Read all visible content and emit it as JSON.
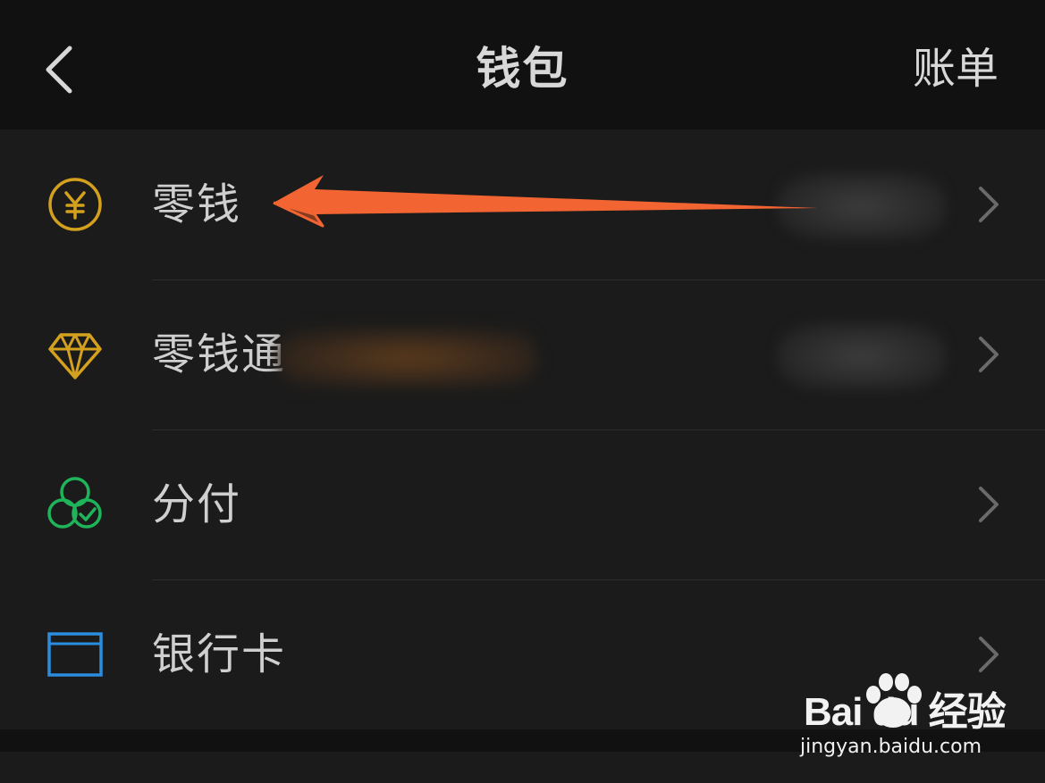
{
  "header": {
    "title": "钱包",
    "right_action": "账单",
    "back_icon": "chevron-left-icon"
  },
  "wallet_items": [
    {
      "label": "零钱",
      "icon": "yuan-coin-icon",
      "icon_color": "#d4a11e",
      "value_hidden": true
    },
    {
      "label": "零钱通",
      "icon": "diamond-icon",
      "icon_color": "#d4a11e",
      "value_hidden": true
    },
    {
      "label": "分付",
      "icon": "overlapping-circles-check-icon",
      "icon_color": "#1fb45a"
    },
    {
      "label": "银行卡",
      "icon": "card-icon",
      "icon_color": "#2b8de0"
    }
  ],
  "annotation": {
    "arrow_color": "#f26532",
    "points_to": "零钱"
  },
  "watermark": {
    "brand": "Bai du 经验",
    "url": "jingyan.baidu.com"
  }
}
